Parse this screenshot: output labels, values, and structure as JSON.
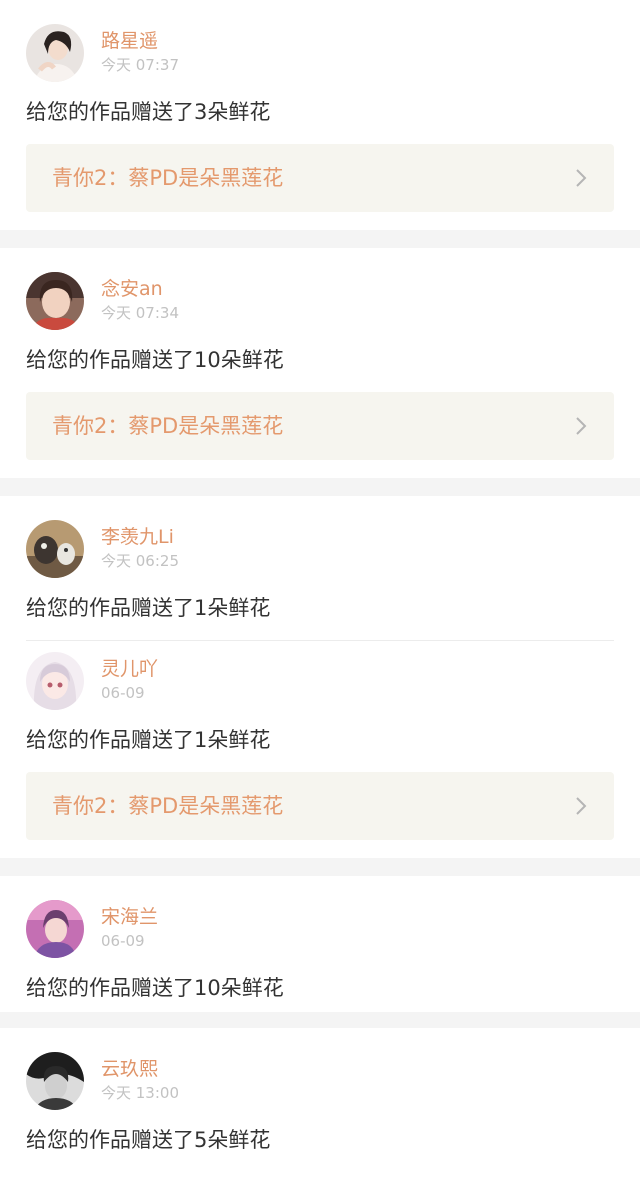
{
  "feed": [
    {
      "entries": [
        {
          "name": "路星遥",
          "time": "今天 07:37",
          "message": "给您的作品赠送了3朵鲜花"
        }
      ],
      "work": "青你2：蔡PD是朵黑莲花"
    },
    {
      "entries": [
        {
          "name": "念安an",
          "time": "今天 07:34",
          "message": "给您的作品赠送了10朵鲜花"
        }
      ],
      "work": "青你2：蔡PD是朵黑莲花"
    },
    {
      "entries": [
        {
          "name": "李羡九Li",
          "time": "今天 06:25",
          "message": "给您的作品赠送了1朵鲜花"
        },
        {
          "name": "灵儿吖",
          "time": "06-09",
          "message": "给您的作品赠送了1朵鲜花"
        }
      ],
      "work": "青你2：蔡PD是朵黑莲花"
    },
    {
      "entries": [
        {
          "name": "宋海兰",
          "time": "06-09",
          "message": "给您的作品赠送了10朵鲜花"
        }
      ]
    },
    {
      "entries": [
        {
          "name": "云玖熙",
          "time": "今天 13:00",
          "message": "给您的作品赠送了5朵鲜花"
        }
      ]
    }
  ],
  "colors": {
    "name": "#e0956a",
    "work_title": "#e4996d",
    "time": "#c2c2c2",
    "message": "#333333",
    "work_bg": "#f6f5ef",
    "page_bg": "#f4f4f4"
  }
}
